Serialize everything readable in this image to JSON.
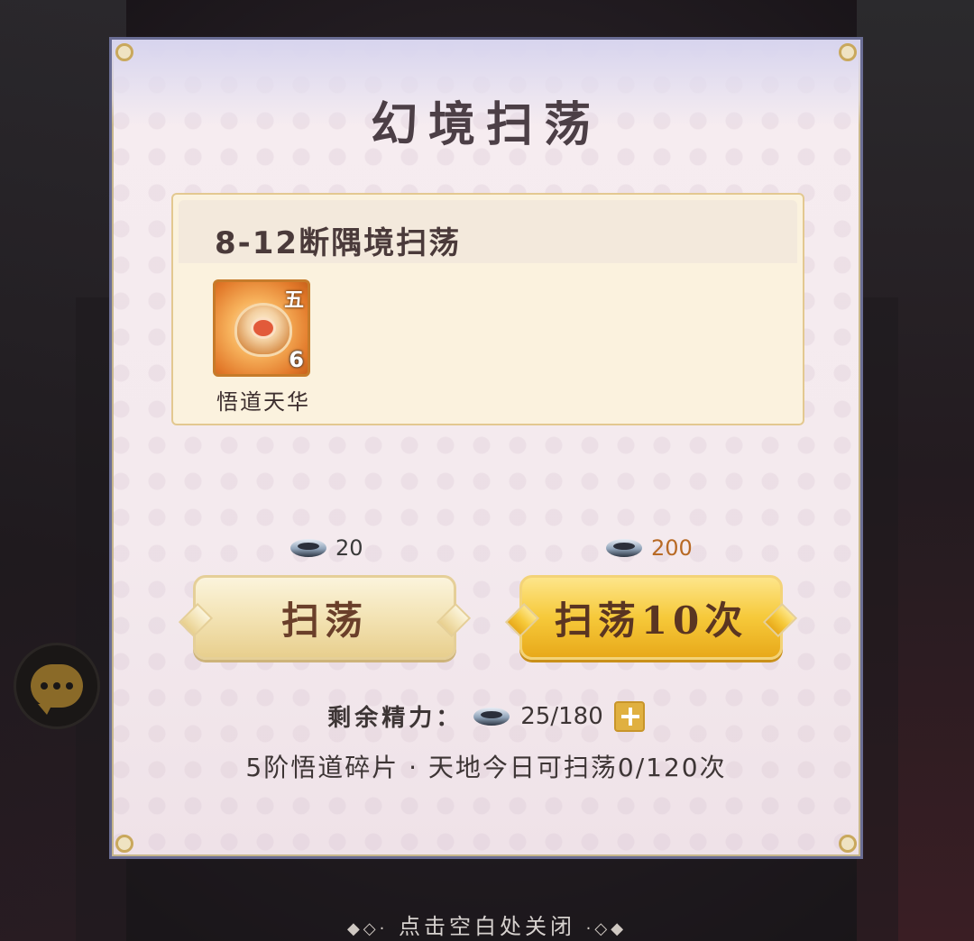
{
  "panel": {
    "title": "幻境扫荡",
    "stage_title": "8-12断隅境扫荡",
    "reward": {
      "name": "悟道天华",
      "tier": "五",
      "count": "6",
      "icon": "dao-fragment-icon"
    },
    "sweep_once": {
      "label": "扫荡",
      "cost": "20",
      "cost_icon": "stamina-icon"
    },
    "sweep_ten": {
      "label": "扫荡10次",
      "cost": "200",
      "cost_icon": "stamina-icon"
    },
    "energy": {
      "label": "剩余精力：",
      "value": "25/180",
      "icon": "stamina-icon",
      "add_icon": "plus-icon"
    },
    "limit_note": "5阶悟道碎片 · 天地今日可扫荡0/120次"
  },
  "close_hint": {
    "text": "点击空白处关闭",
    "left_deco": "◆◇·",
    "right_deco": "·◇◆"
  },
  "chat": {
    "icon": "chat-bubble-icon"
  },
  "colors": {
    "panel_border": "#6a6d94",
    "gold_button": "#f6c93a",
    "cost_highlight": "#b86a25"
  }
}
